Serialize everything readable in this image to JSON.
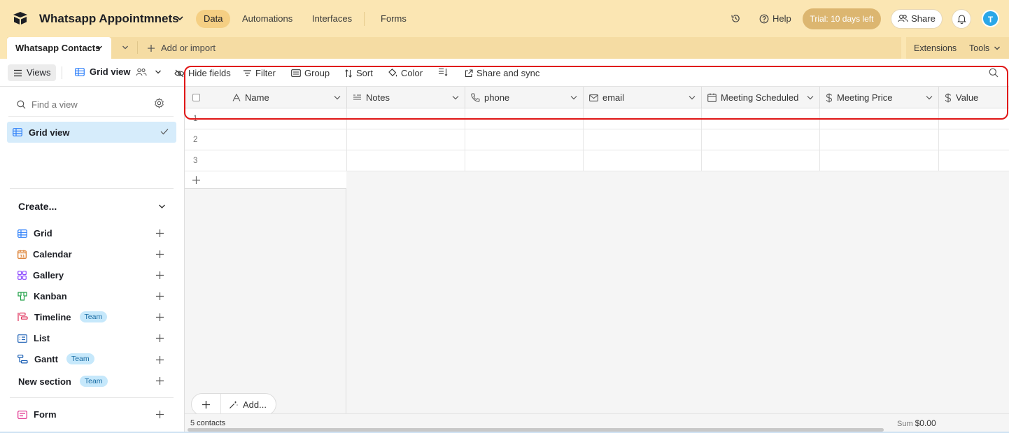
{
  "header": {
    "base_title": "Whatsapp Appointmnets",
    "nav": [
      "Data",
      "Automations",
      "Interfaces",
      "Forms"
    ],
    "help_label": "Help",
    "trial_label": "Trial: 10 days left",
    "share_label": "Share",
    "avatar_initial": "T"
  },
  "tabbar": {
    "table_tab": "Whatsapp Contacts",
    "add_import": "Add or import",
    "extensions": "Extensions",
    "tools": "Tools"
  },
  "viewbar": {
    "views_label": "Views",
    "grid_view_label": "Grid view",
    "hide_fields": "Hide fields",
    "filter": "Filter",
    "group": "Group",
    "sort": "Sort",
    "color": "Color",
    "share_sync": "Share and sync"
  },
  "sidebar": {
    "find_placeholder": "Find a view",
    "active_view": "Grid view",
    "create_title": "Create...",
    "create_items": [
      {
        "label": "Grid",
        "badge": ""
      },
      {
        "label": "Calendar",
        "badge": ""
      },
      {
        "label": "Gallery",
        "badge": ""
      },
      {
        "label": "Kanban",
        "badge": ""
      },
      {
        "label": "Timeline",
        "badge": "Team"
      },
      {
        "label": "List",
        "badge": ""
      },
      {
        "label": "Gantt",
        "badge": "Team"
      },
      {
        "label": "New section",
        "badge": "Team"
      },
      {
        "label": "Form",
        "badge": ""
      }
    ]
  },
  "grid": {
    "columns": [
      "Name",
      "Notes",
      "phone",
      "email",
      "Meeting Scheduled",
      "Meeting Price",
      "Value"
    ],
    "rows": [
      "1",
      "2",
      "3"
    ],
    "add_label": "Add...",
    "record_count": "5 contacts",
    "sum_label": "Sum",
    "sum_value": "$0.00"
  },
  "colors": {
    "header_bg": "#fbe6b3",
    "active_view_bg": "#d6ecfb",
    "highlight": "#e01616"
  }
}
